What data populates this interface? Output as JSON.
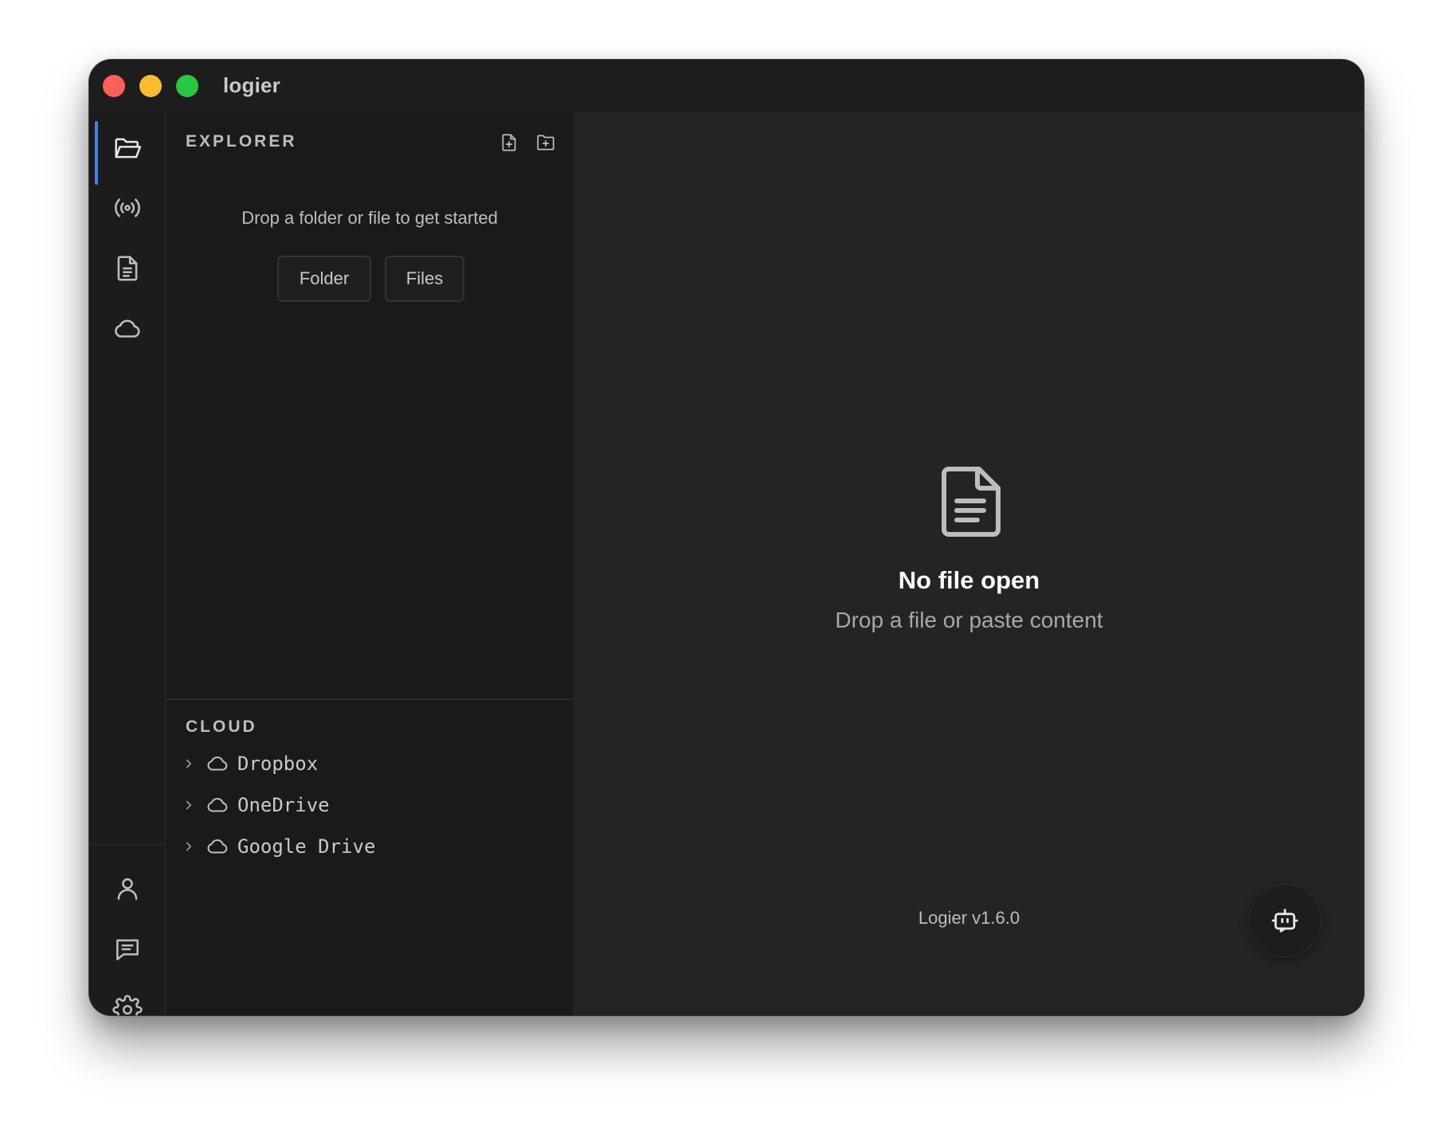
{
  "window": {
    "title": "logier"
  },
  "activity_bar": {
    "top_items": [
      {
        "icon": "folder-open-icon",
        "active": true
      },
      {
        "icon": "broadcast-icon",
        "active": false
      },
      {
        "icon": "document-icon",
        "active": false
      },
      {
        "icon": "cloud-icon",
        "active": false
      }
    ],
    "bottom_items": [
      {
        "icon": "user-icon"
      },
      {
        "icon": "message-icon"
      },
      {
        "icon": "gear-icon"
      }
    ],
    "accent_color": "#3b82f6"
  },
  "explorer": {
    "header": "EXPLORER",
    "header_actions": [
      "new-file-icon",
      "new-folder-icon"
    ],
    "drop_message": "Drop a folder or file to get started",
    "folder_button": "Folder",
    "files_button": "Files"
  },
  "cloud": {
    "header": "CLOUD",
    "items": [
      {
        "label": "Dropbox",
        "icon": "cloud-icon"
      },
      {
        "label": "OneDrive",
        "icon": "cloud-icon"
      },
      {
        "label": "Google Drive",
        "icon": "cloud-icon"
      }
    ]
  },
  "main": {
    "empty_icon": "document-icon",
    "empty_title": "No file open",
    "empty_subtitle": "Drop a file or paste content",
    "version": "Logier v1.6.0",
    "fab_icon": "bot-icon"
  }
}
